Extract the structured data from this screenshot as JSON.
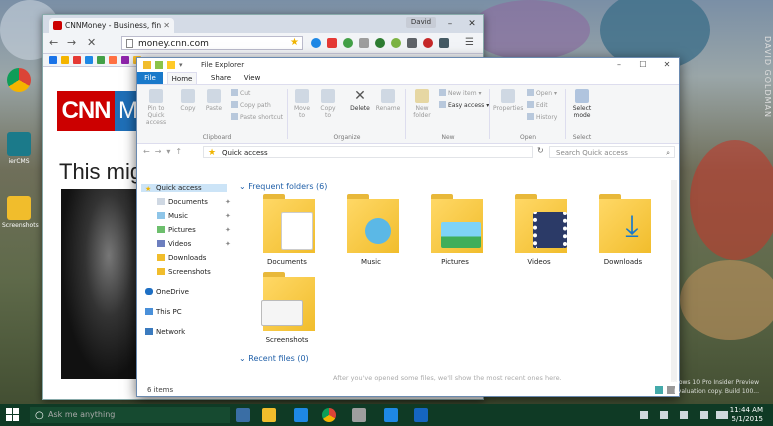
{
  "desktop": {
    "icons": [
      {
        "label": ""
      },
      {
        "label": "ierCMS"
      },
      {
        "label": "Screenshots"
      }
    ],
    "watermark": "DAVID GOLDMAN",
    "eval_text_line1": "Windows 10 Pro Insider Preview",
    "eval_text_line2": "Evaluation copy. Build 100..."
  },
  "browser": {
    "tab_title": "CNNMoney - Business, fin",
    "user_chip": "David",
    "url": "money.cnn.com",
    "page": {
      "logo_text": "CNN",
      "money_text": "M",
      "headline": "This mig"
    }
  },
  "explorer": {
    "title": "File Explorer",
    "tabs": {
      "file": "File",
      "home": "Home",
      "share": "Share",
      "view": "View"
    },
    "ribbon": {
      "pin": "Pin to Quick access",
      "copy": "Copy",
      "paste": "Paste",
      "cut": "Cut",
      "copy_path": "Copy path",
      "paste_shortcut": "Paste shortcut",
      "move_to": "Move to",
      "copy_to": "Copy to",
      "delete": "Delete",
      "rename": "Rename",
      "new_folder": "New folder",
      "new_item": "New item",
      "easy_access": "Easy access",
      "properties": "Properties",
      "open": "Open",
      "edit": "Edit",
      "history": "History",
      "select_mode": "Select mode",
      "groups": {
        "clipboard": "Clipboard",
        "organize": "Organize",
        "new": "New",
        "open": "Open",
        "select": "Select"
      }
    },
    "address": {
      "path": "Quick access",
      "search_placeholder": "Search Quick access"
    },
    "nav": {
      "quick_access": "Quick access",
      "documents": "Documents",
      "music": "Music",
      "pictures": "Pictures",
      "videos": "Videos",
      "downloads": "Downloads",
      "screenshots": "Screenshots",
      "onedrive": "OneDrive",
      "this_pc": "This PC",
      "network": "Network"
    },
    "frequent_header": "Frequent folders (6)",
    "recent_header": "Recent files (0)",
    "recent_hint": "After you've opened some files, we'll show the most recent ones here.",
    "folders": [
      "Documents",
      "Music",
      "Pictures",
      "Videos",
      "Downloads",
      "Screenshots"
    ],
    "status": "6 items"
  },
  "taskbar": {
    "search_placeholder": "Ask me anything",
    "time": "11:44 AM",
    "date": "5/1/2015"
  },
  "colors": {
    "accent": "#1979ca",
    "folder": "#f1bd2c",
    "taskbar": "#0f3a25",
    "cnn_red": "#cc0000"
  }
}
